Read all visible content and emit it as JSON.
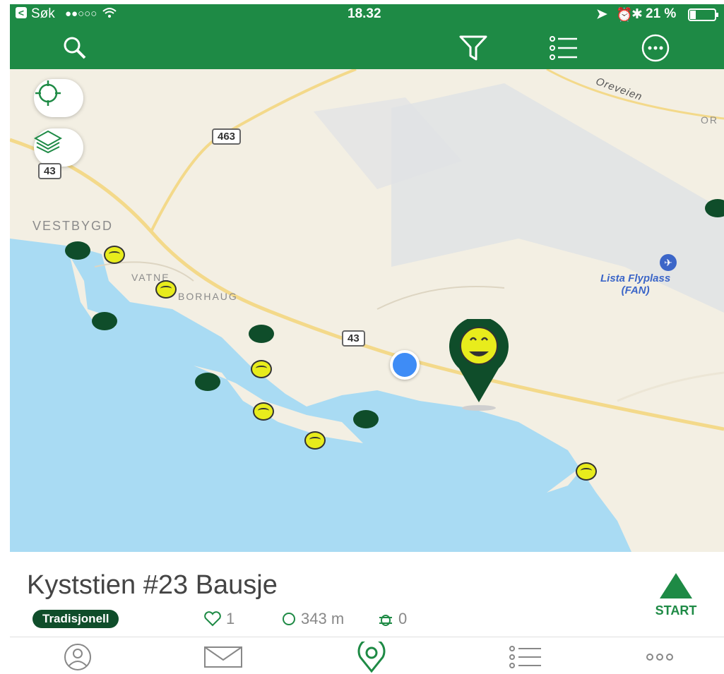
{
  "status_bar": {
    "back_label": "Søk",
    "signal": "●●○○○",
    "time": "18.32",
    "battery": "21 %"
  },
  "toolbar": {
    "icons": [
      "search-icon",
      "filter-icon",
      "list-icon",
      "more-icon"
    ]
  },
  "map": {
    "labels": {
      "vestbygd": "VESTBYGD",
      "vatne": "VATNE",
      "borhaug": "BORHAUG",
      "oreveien": "Oreveien",
      "or": "OR",
      "airport_1": "Lista Flyplass",
      "airport_2": "(FAN)"
    },
    "roads": {
      "r463": "463",
      "r43_a": "43",
      "r43_b": "43"
    },
    "colors": {
      "water": "#a9dbf3",
      "land": "#f3efe3",
      "runway": "#dfe2e5",
      "road": "#f3d98a",
      "poi": "#0f4d2a",
      "smiley": "#e8ec1c",
      "location": "#3e8cf6"
    }
  },
  "cache": {
    "title": "Kyststien #23 Bausje",
    "type": "Tradisjonell",
    "favorites": "1",
    "distance": "343 m",
    "trackables": "0",
    "start_label": "START"
  },
  "tabs": [
    "profile-tab",
    "messages-tab",
    "map-tab",
    "lists-tab",
    "more-tab"
  ]
}
